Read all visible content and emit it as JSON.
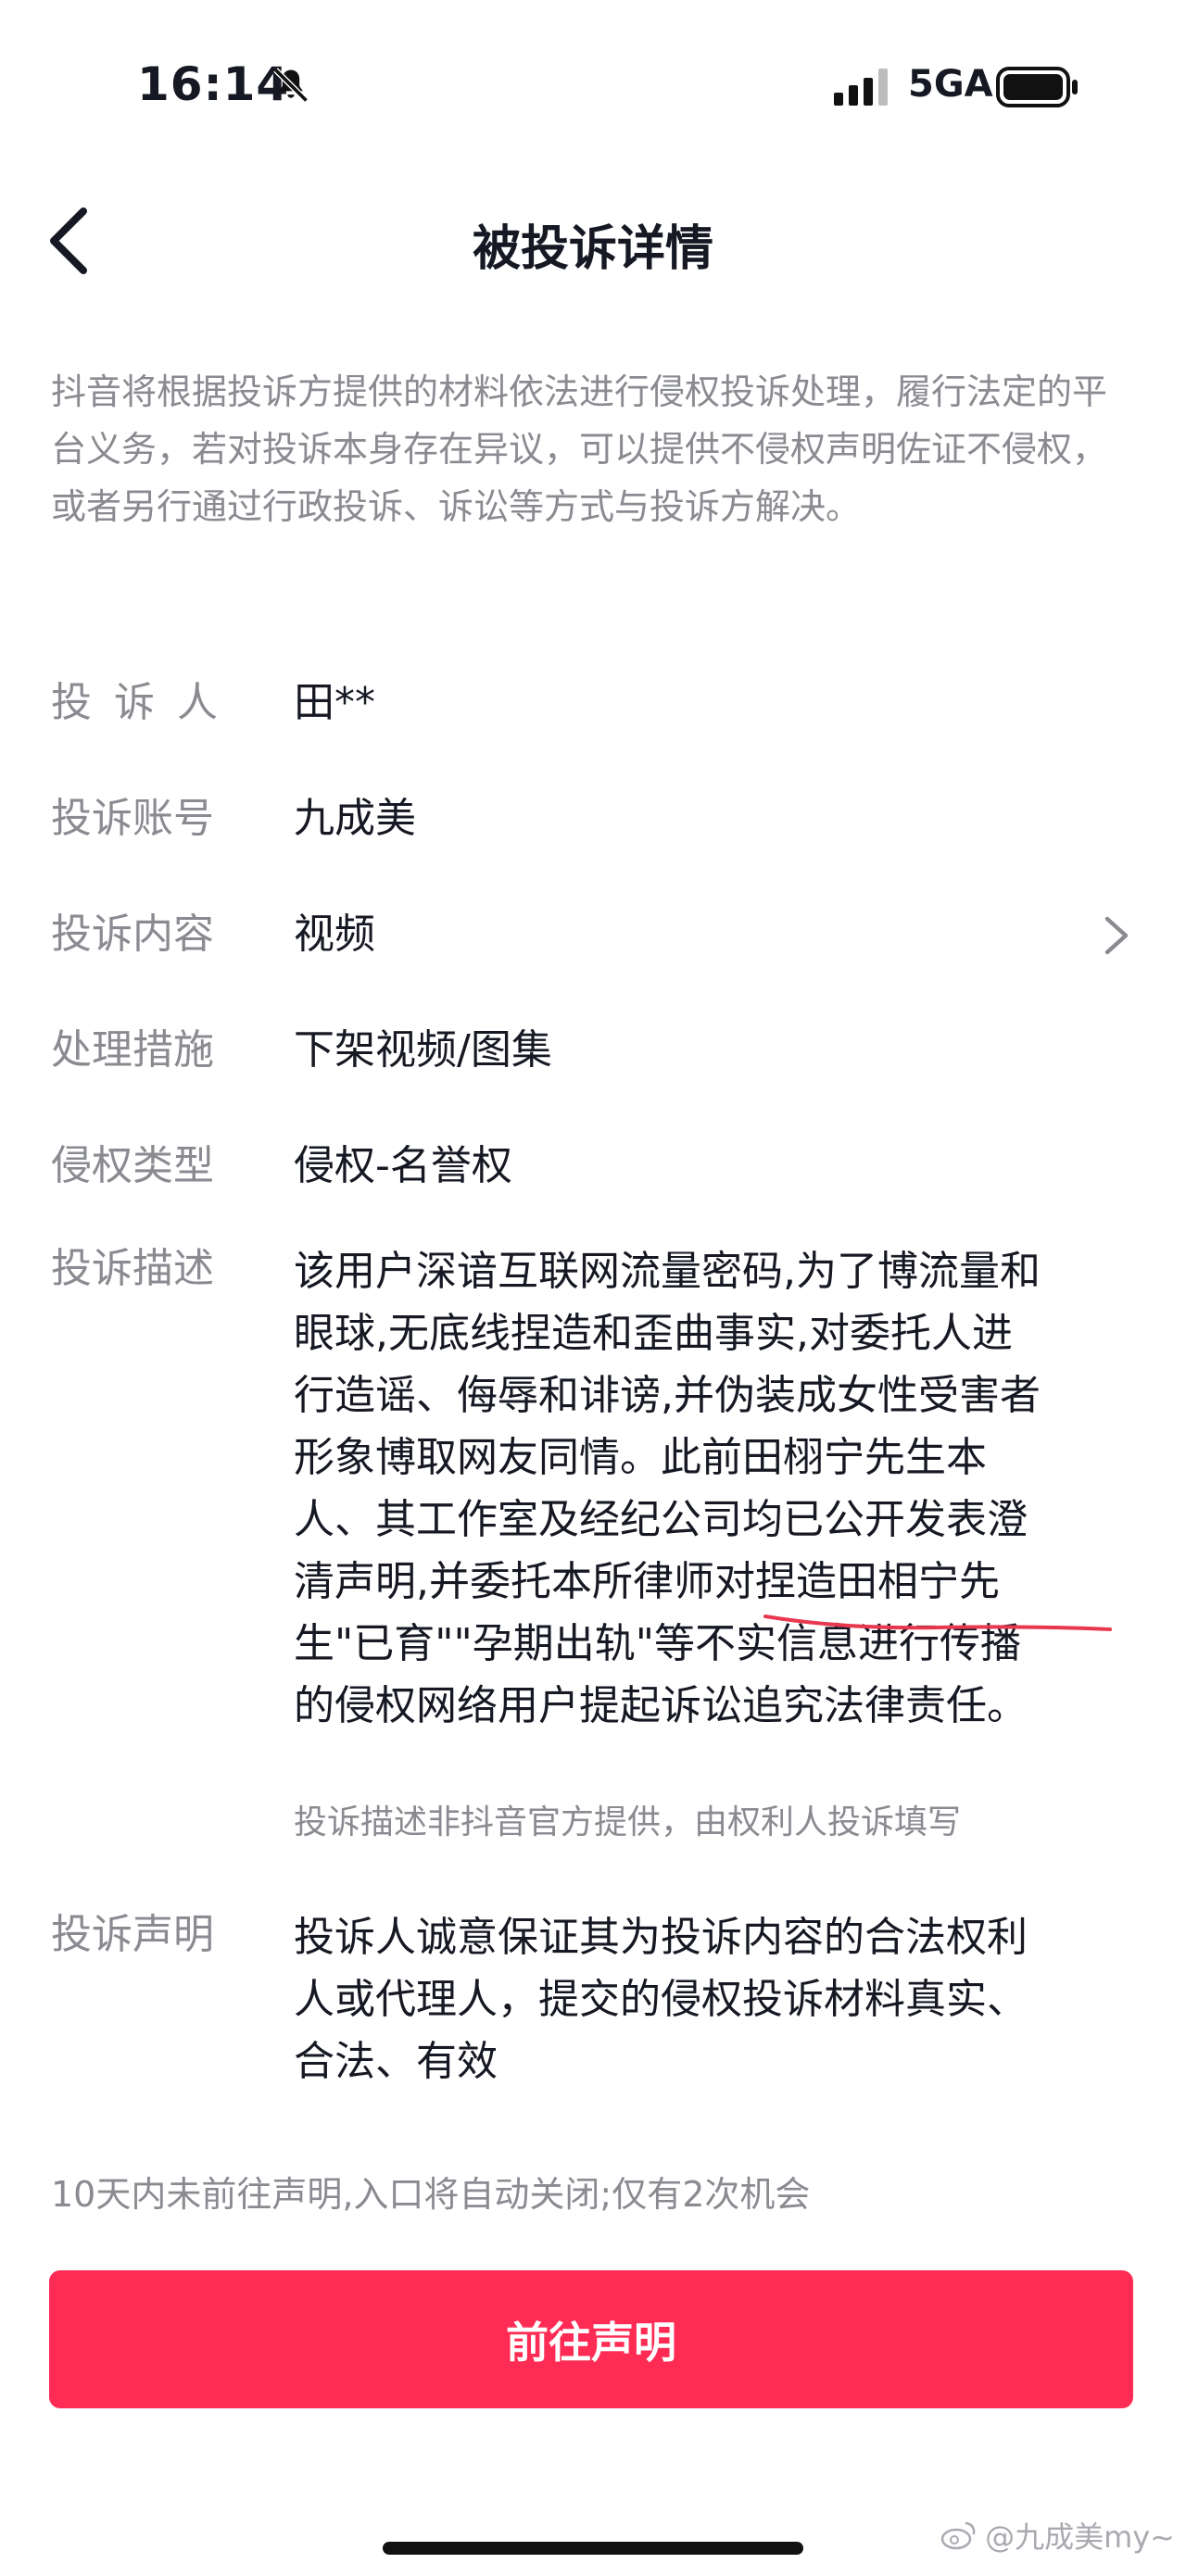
{
  "status_bar": {
    "time": "16:14",
    "network": "5GA",
    "icons": [
      "mute-bell-icon",
      "signal-icon",
      "battery-icon"
    ]
  },
  "nav": {
    "title": "被投诉详情",
    "back_icon": "chevron-left-icon"
  },
  "notice": "抖音将根据投诉方提供的材料依法进行侵权投诉处理，履行法定的平台义务，若对投诉本身存在异议，可以提供不侵权声明佐证不侵权，或者另行通过行政投诉、诉讼等方式与投诉方解决。",
  "details": {
    "complainant": {
      "label": "投诉人",
      "value": "田**"
    },
    "account": {
      "label": "投诉账号",
      "value": "九成美"
    },
    "content": {
      "label": "投诉内容",
      "value": "视频"
    },
    "measure": {
      "label": "处理措施",
      "value": "下架视频/图集"
    },
    "type": {
      "label": "侵权类型",
      "value": "侵权-名誉权"
    },
    "description": {
      "label": "投诉描述",
      "lines": [
        "该用户深谙互联网流量密码,为了博流量和",
        "眼球,无底线捏造和歪曲事实,对委托人进",
        "行造谣、侮辱和诽谤,并伪装成女性受害者",
        "形象博取网友同情。此前田栩宁先生本",
        "人、其工作室及经纪公司均已公开发表澄",
        "清声明,并委托本所律师对捏造田相宁先",
        "生\"已育\"\"孕期出轨\"等不实信息进行传播",
        "的侵权网络用户提起诉讼追究法律责任。"
      ],
      "note": "投诉描述非抖音官方提供，由权利人投诉填写"
    },
    "statement": {
      "label": "投诉声明",
      "lines": [
        "投诉人诚意保证其为投诉内容的合法权利",
        "人或代理人，提交的侵权投诉材料真实、",
        "合法、有效"
      ]
    }
  },
  "deadline_text": "10天内未前往声明,入口将自动关闭;仅有2次机会",
  "primary_button": "前往声明",
  "watermark": "@九成美my~",
  "colors": {
    "primary": "#fe2c55",
    "label_gray": "#8a8b91",
    "text": "#161823",
    "underline_mark": "#e8384f"
  }
}
